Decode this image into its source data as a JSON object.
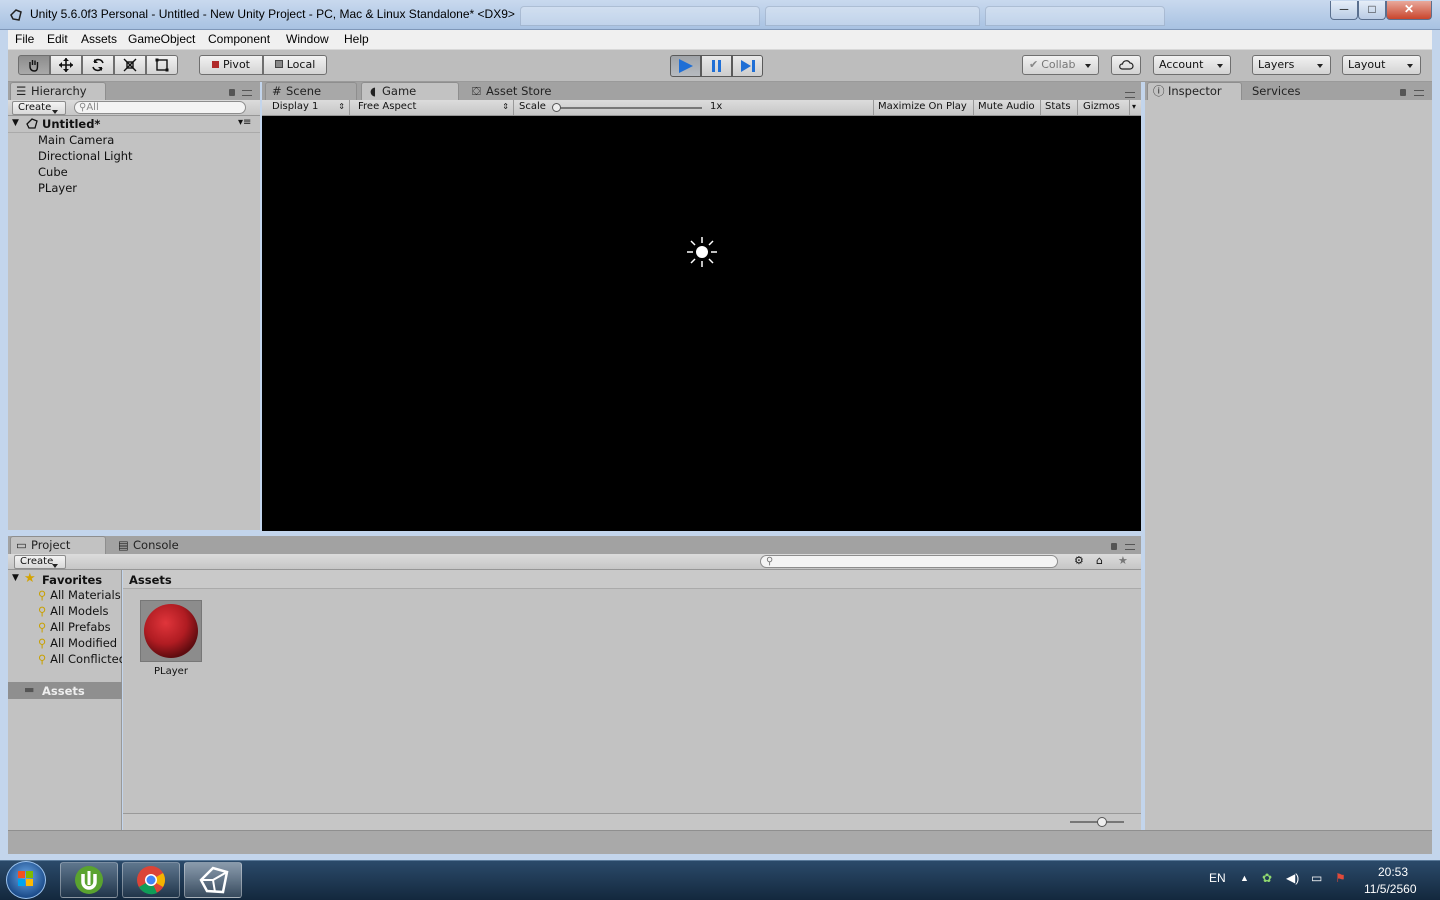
{
  "window": {
    "title": "Unity 5.6.0f3 Personal - Untitled - New Unity Project - PC, Mac & Linux Standalone* <DX9>",
    "min": "─",
    "max": "□",
    "close": "✕"
  },
  "menu": [
    "File",
    "Edit",
    "Assets",
    "GameObject",
    "Component",
    "Window",
    "Help"
  ],
  "toolbar": {
    "tools": [
      "hand-icon",
      "move-icon",
      "rotate-icon",
      "scale-icon",
      "rect-icon"
    ],
    "pivot": "Pivot",
    "local": "Local",
    "collab": "Collab",
    "account": "Account",
    "layers": "Layers",
    "layout": "Layout"
  },
  "hierarchy": {
    "tab": "Hierarchy",
    "create": "Create",
    "search_placeholder": "All",
    "scene": "Untitled*",
    "items": [
      "Main Camera",
      "Directional Light",
      "Cube",
      "PLayer"
    ]
  },
  "center": {
    "tabs": [
      "Scene",
      "Game",
      "Asset Store"
    ],
    "display": "Display 1",
    "aspect": "Free Aspect",
    "scale_label": "Scale",
    "scale_value": "1x",
    "maximize": "Maximize On Play",
    "mute": "Mute Audio",
    "stats": "Stats",
    "gizmos": "Gizmos"
  },
  "inspector": {
    "tabs": [
      "Inspector",
      "Services"
    ]
  },
  "project": {
    "tabs": [
      "Project",
      "Console"
    ],
    "create": "Create",
    "favorites_label": "Favorites",
    "favorites": [
      "All Materials",
      "All Models",
      "All Prefabs",
      "All Modified",
      "All Conflicted"
    ],
    "assets_folder": "Assets",
    "breadcrumb": "Assets",
    "asset_items": [
      {
        "name": "PLayer",
        "color": "#b01c22"
      }
    ]
  },
  "taskbar": {
    "apps": [
      "utorrent-icon",
      "chrome-icon",
      "unity-icon"
    ],
    "lang": "EN",
    "time": "20:53",
    "date": "11/5/2560"
  },
  "colors": {
    "play_accent": "#1f6fd6",
    "asset_red": "#b01c22"
  }
}
